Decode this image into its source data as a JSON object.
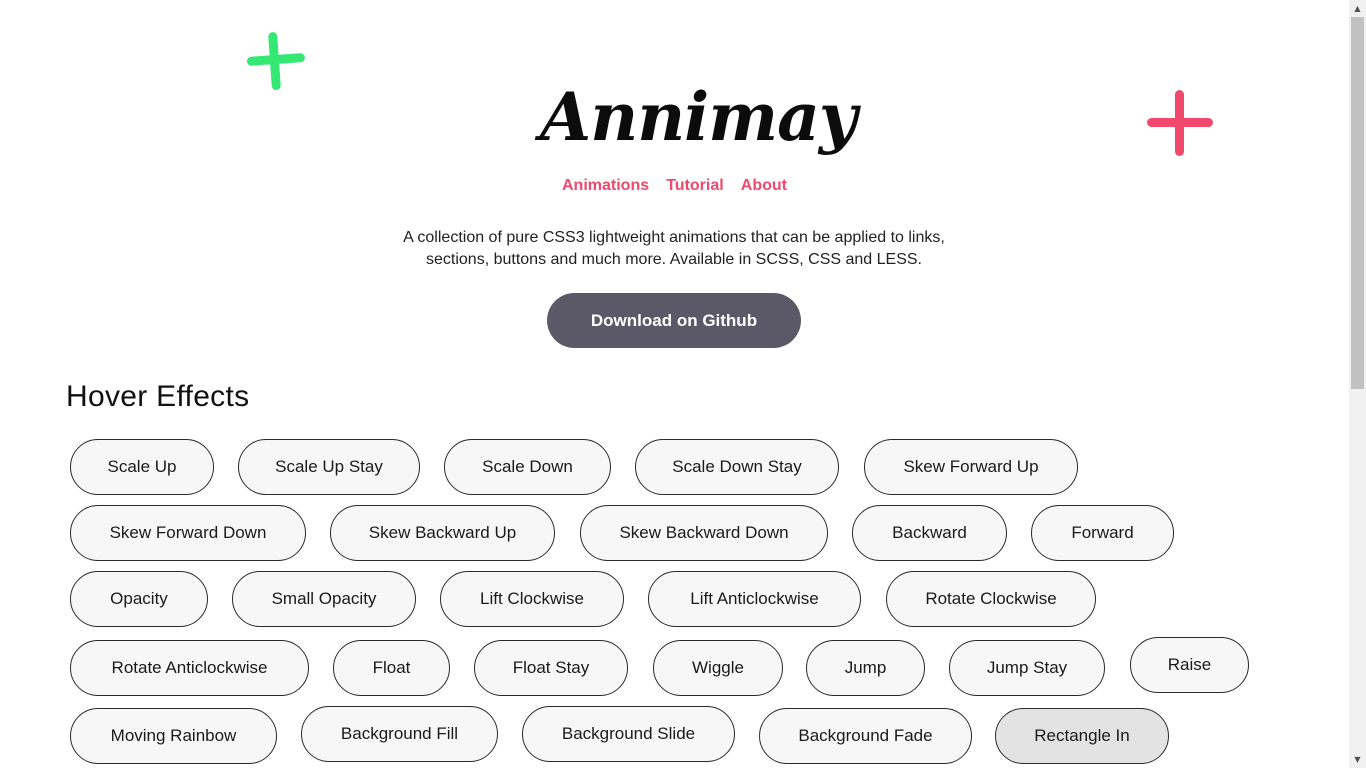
{
  "logo": {
    "text": "Annimay"
  },
  "nav": {
    "items": [
      "Animations",
      "Tutorial",
      "About"
    ]
  },
  "description": "A collection of pure CSS3 lightweight animations that can be applied to links, sections, buttons and much more. Available in SCSS, CSS and LESS.",
  "cta": {
    "label": "Download on Github"
  },
  "hover_effects": {
    "title": "Hover Effects",
    "rows": [
      [
        "Scale Up",
        "Scale Up Stay",
        "Scale Down",
        "Scale Down Stay",
        "Skew Forward Up"
      ],
      [
        "Skew Forward Down",
        "Skew Backward Up",
        "Skew Backward Down",
        "Backward",
        "Forward"
      ],
      [
        "Opacity",
        "Small Opacity",
        "Lift Clockwise",
        "Lift Anticlockwise",
        "Rotate Clockwise"
      ],
      [
        "Rotate Anticlockwise",
        "Float",
        "Float Stay",
        "Wiggle",
        "Jump",
        "Jump Stay",
        "Raise"
      ],
      [
        "Moving Rainbow",
        "Background Fill",
        "Background Slide",
        "Background Fade",
        "Rectangle In"
      ]
    ],
    "active": "Rectangle In"
  },
  "colors": {
    "accent": "#f1496d",
    "plus_green": "#35e874",
    "plus_red": "#f1496d",
    "button_dark": "#5b5968",
    "pill_bg": "#f7f7f7",
    "pill_active_bg": "#e3e3e3"
  },
  "icons": {
    "plus_left": "plus-icon",
    "plus_right": "plus-icon",
    "scroll_up": "triangle-up-icon",
    "scroll_down": "triangle-down-icon"
  }
}
